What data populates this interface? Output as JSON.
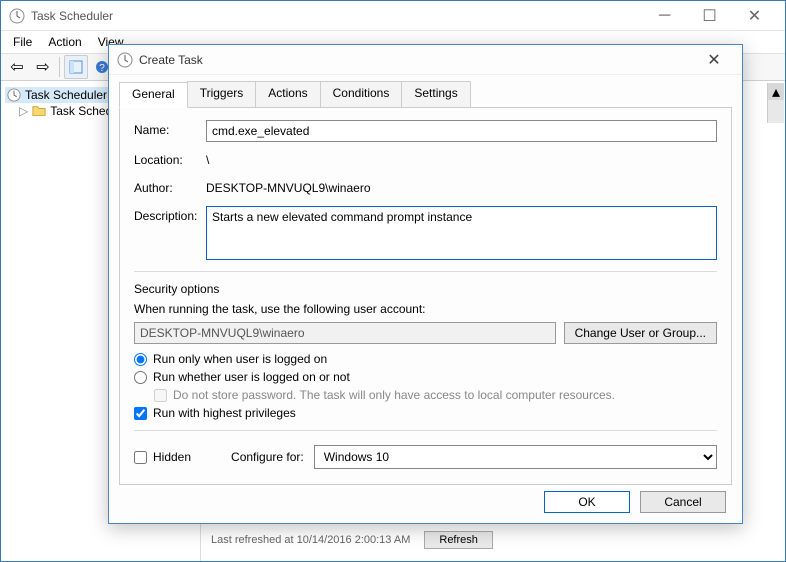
{
  "mainWindow": {
    "title": "Task Scheduler",
    "menus": [
      "File",
      "Action",
      "View"
    ],
    "tree": {
      "root": "Task Scheduler",
      "child": "Task Scheduler"
    },
    "status": "Last refreshed at 10/14/2016 2:00:13 AM",
    "refresh": "Refresh"
  },
  "dialog": {
    "title": "Create Task",
    "tabs": [
      "General",
      "Triggers",
      "Actions",
      "Conditions",
      "Settings"
    ],
    "activeTab": 0,
    "labels": {
      "name": "Name:",
      "location": "Location:",
      "author": "Author:",
      "description": "Description:",
      "securityOptions": "Security options",
      "whenRunning": "When running the task, use the following user account:",
      "changeUser": "Change User or Group...",
      "runOnly": "Run only when user is logged on",
      "runWhether": "Run whether user is logged on or not",
      "doNotStore": "Do not store password.  The task will only have access to local computer resources.",
      "runHighest": "Run with highest privileges",
      "hidden": "Hidden",
      "configureFor": "Configure for:"
    },
    "values": {
      "name": "cmd.exe_elevated",
      "location": "\\",
      "author": "DESKTOP-MNVUQL9\\winaero",
      "description": "Starts a new elevated command prompt instance",
      "account": "DESKTOP-MNVUQL9\\winaero",
      "configureFor": "Windows 10"
    },
    "buttons": {
      "ok": "OK",
      "cancel": "Cancel"
    }
  }
}
